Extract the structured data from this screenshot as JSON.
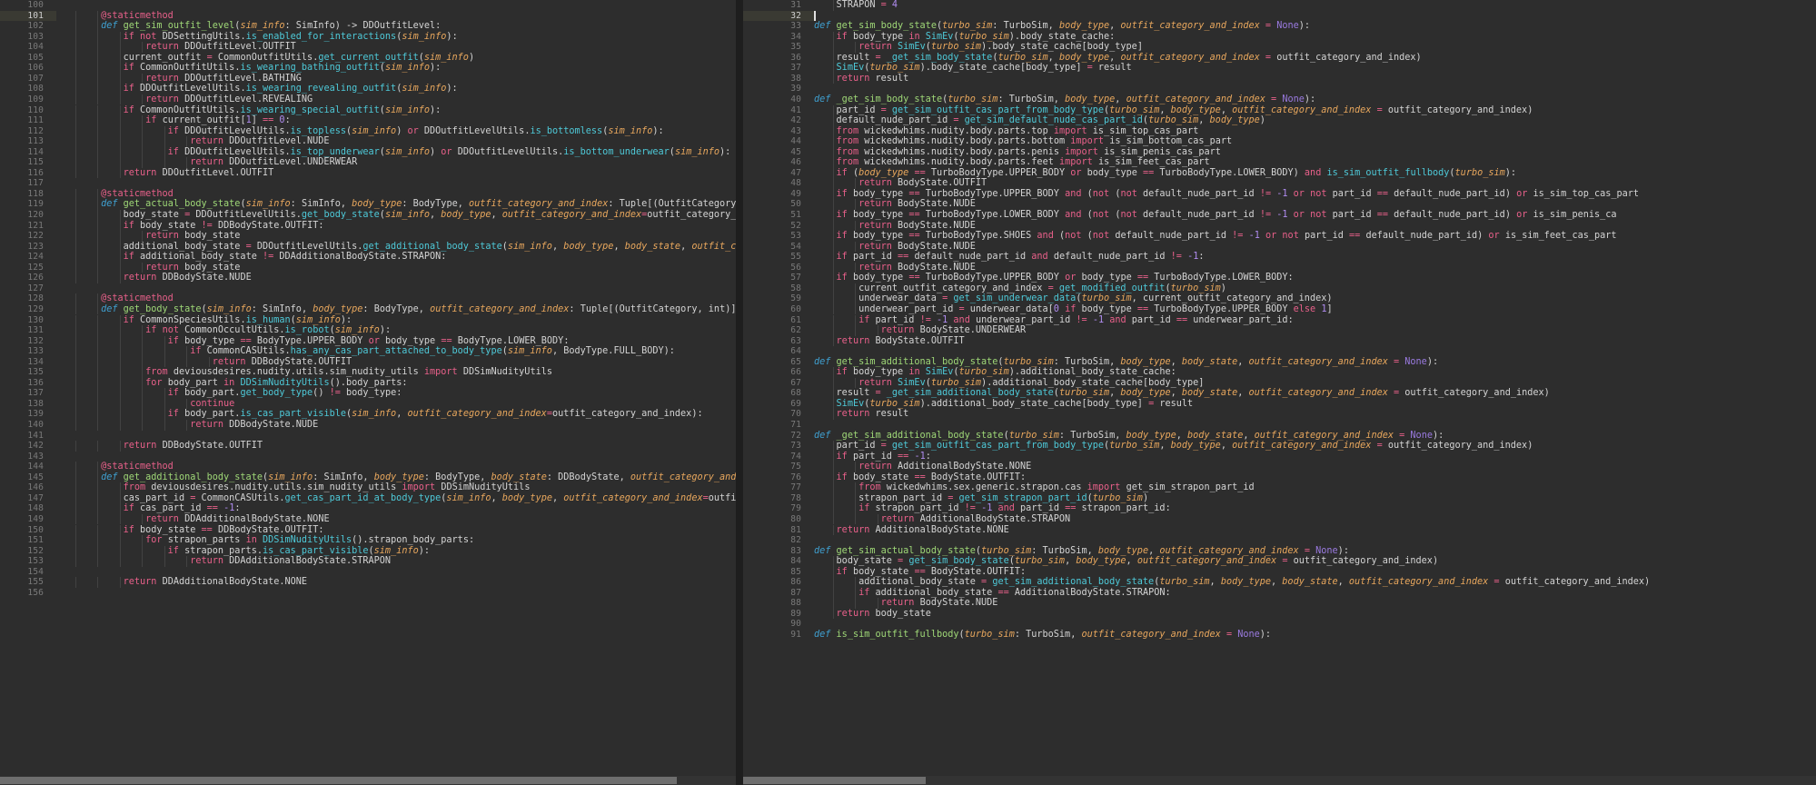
{
  "editor": {
    "theme_bg": "#2d2d2d",
    "gutter_fg": "#797979",
    "active_line_bg": "#3a3a33",
    "divider_color": "#1e1e1e",
    "scrollbar_thumb": "#6e6e6e"
  },
  "left_pane": {
    "name": "left-editor-pane",
    "language": "python",
    "first_visible_line": 100,
    "active_line": 101,
    "horizontal_scroll_thumb_percent": 92,
    "lines": [
      {
        "n": 100,
        "text": ""
      },
      {
        "n": 101,
        "text": "        @staticmethod"
      },
      {
        "n": 102,
        "text": "        def get_sim_outfit_level(sim_info: SimInfo) -> DDOutfitLevel:"
      },
      {
        "n": 103,
        "text": "            if not DDSettingUtils.is_enabled_for_interactions(sim_info):"
      },
      {
        "n": 104,
        "text": "                return DDOutfitLevel.OUTFIT"
      },
      {
        "n": 105,
        "text": "            current_outfit = CommonOutfitUtils.get_current_outfit(sim_info)"
      },
      {
        "n": 106,
        "text": "            if CommonOutfitUtils.is_wearing_bathing_outfit(sim_info):"
      },
      {
        "n": 107,
        "text": "                return DDOutfitLevel.BATHING"
      },
      {
        "n": 108,
        "text": "            if DDOutfitLevelUtils.is_wearing_revealing_outfit(sim_info):"
      },
      {
        "n": 109,
        "text": "                return DDOutfitLevel.REVEALING"
      },
      {
        "n": 110,
        "text": "            if CommonOutfitUtils.is_wearing_special_outfit(sim_info):"
      },
      {
        "n": 111,
        "text": "                if current_outfit[1] == 0:"
      },
      {
        "n": 112,
        "text": "                    if DDOutfitLevelUtils.is_topless(sim_info) or DDOutfitLevelUtils.is_bottomless(sim_info):"
      },
      {
        "n": 113,
        "text": "                        return DDOutfitLevel.NUDE"
      },
      {
        "n": 114,
        "text": "                    if DDOutfitLevelUtils.is_top_underwear(sim_info) or DDOutfitLevelUtils.is_bottom_underwear(sim_info):"
      },
      {
        "n": 115,
        "text": "                        return DDOutfitLevel.UNDERWEAR"
      },
      {
        "n": 116,
        "text": "            return DDOutfitLevel.OUTFIT"
      },
      {
        "n": 117,
        "text": ""
      },
      {
        "n": 118,
        "text": "        @staticmethod"
      },
      {
        "n": 119,
        "text": "        def get_actual_body_state(sim_info: SimInfo, body_type: BodyType, outfit_category_and_index: Tuple[(OutfitCategory, int)]=None) -> DDBodyState:"
      },
      {
        "n": 120,
        "text": "            body_state = DDOutfitLevelUtils.get_body_state(sim_info, body_type, outfit_category_and_index=outfit_category_and_index)"
      },
      {
        "n": 121,
        "text": "            if body_state != DDBodyState.OUTFIT:"
      },
      {
        "n": 122,
        "text": "                return body_state"
      },
      {
        "n": 123,
        "text": "            additional_body_state = DDOutfitLevelUtils.get_additional_body_state(sim_info, body_type, body_state, outfit_category_and_index=outfit_category_and_index)"
      },
      {
        "n": 124,
        "text": "            if additional_body_state != DDAdditionalBodyState.STRAPON:"
      },
      {
        "n": 125,
        "text": "                return body_state"
      },
      {
        "n": 126,
        "text": "            return DDBodyState.NUDE"
      },
      {
        "n": 127,
        "text": ""
      },
      {
        "n": 128,
        "text": "        @staticmethod"
      },
      {
        "n": 129,
        "text": "        def get_body_state(sim_info: SimInfo, body_type: BodyType, outfit_category_and_index: Tuple[(OutfitCategory, int)]=None) -> DDBodyState:"
      },
      {
        "n": 130,
        "text": "            if CommonSpeciesUtils.is_human(sim_info):"
      },
      {
        "n": 131,
        "text": "                if not CommonOccultUtils.is_robot(sim_info):"
      },
      {
        "n": 132,
        "text": "                    if body_type == BodyType.UPPER_BODY or body_type == BodyType.LOWER_BODY:"
      },
      {
        "n": 133,
        "text": "                        if CommonCASUtils.has_any_cas_part_attached_to_body_type(sim_info, BodyType.FULL_BODY):"
      },
      {
        "n": 134,
        "text": "                            return DDBodyState.OUTFIT"
      },
      {
        "n": 135,
        "text": "                from deviousdesires.nudity.utils.sim_nudity_utils import DDSimNudityUtils"
      },
      {
        "n": 136,
        "text": "                for body_part in DDSimNudityUtils().body_parts:"
      },
      {
        "n": 137,
        "text": "                    if body_part.get_body_type() != body_type:"
      },
      {
        "n": 138,
        "text": "                        continue"
      },
      {
        "n": 139,
        "text": "                    if body_part.is_cas_part_visible(sim_info, outfit_category_and_index=outfit_category_and_index):"
      },
      {
        "n": 140,
        "text": "                        return DDBodyState.NUDE"
      },
      {
        "n": 141,
        "text": ""
      },
      {
        "n": 142,
        "text": "            return DDBodyState.OUTFIT"
      },
      {
        "n": 143,
        "text": ""
      },
      {
        "n": 144,
        "text": "        @staticmethod"
      },
      {
        "n": 145,
        "text": "        def get_additional_body_state(sim_info: SimInfo, body_type: BodyType, body_state: DDBodyState, outfit_category_and_index: Tuple[(OutfitCategory, int)]=None) -> DDAdditionalBodyState:"
      },
      {
        "n": 146,
        "text": "            from deviousdesires.nudity.utils.sim_nudity_utils import DDSimNudityUtils"
      },
      {
        "n": 147,
        "text": "            cas_part_id = CommonCASUtils.get_cas_part_id_at_body_type(sim_info, body_type, outfit_category_and_index=outfit_category_and_index)"
      },
      {
        "n": 148,
        "text": "            if cas_part_id == -1:"
      },
      {
        "n": 149,
        "text": "                return DDAdditionalBodyState.NONE"
      },
      {
        "n": 150,
        "text": "            if body_state == DDBodyState.OUTFIT:"
      },
      {
        "n": 151,
        "text": "                for strapon_parts in DDSimNudityUtils().strapon_body_parts:"
      },
      {
        "n": 152,
        "text": "                    if strapon_parts.is_cas_part_visible(sim_info):"
      },
      {
        "n": 153,
        "text": "                        return DDAdditionalBodyState.STRAPON"
      },
      {
        "n": 154,
        "text": ""
      },
      {
        "n": 155,
        "text": "            return DDAdditionalBodyState.NONE"
      },
      {
        "n": 156,
        "text": ""
      }
    ]
  },
  "right_pane": {
    "name": "right-editor-pane",
    "language": "python",
    "first_visible_line": 31,
    "active_line": 32,
    "cursor_line": 32,
    "cursor_column": 1,
    "horizontal_scroll_thumb_percent": 17,
    "lines": [
      {
        "n": 31,
        "text": "    STRAPON = 4"
      },
      {
        "n": 32,
        "text": ""
      },
      {
        "n": 33,
        "text": "def get_sim_body_state(turbo_sim: TurboSim, body_type, outfit_category_and_index = None):"
      },
      {
        "n": 34,
        "text": "    if body_type in SimEv(turbo_sim).body_state_cache:"
      },
      {
        "n": 35,
        "text": "        return SimEv(turbo_sim).body_state_cache[body_type]"
      },
      {
        "n": 36,
        "text": "    result = _get_sim_body_state(turbo_sim, body_type, outfit_category_and_index = outfit_category_and_index)"
      },
      {
        "n": 37,
        "text": "    SimEv(turbo_sim).body_state_cache[body_type] = result"
      },
      {
        "n": 38,
        "text": "    return result"
      },
      {
        "n": 39,
        "text": ""
      },
      {
        "n": 40,
        "text": "def _get_sim_body_state(turbo_sim: TurboSim, body_type, outfit_category_and_index = None):"
      },
      {
        "n": 41,
        "text": "    part_id = get_sim_outfit_cas_part_from_body_type(turbo_sim, body_type, outfit_category_and_index = outfit_category_and_index)"
      },
      {
        "n": 42,
        "text": "    default_nude_part_id = get_sim_default_nude_cas_part_id(turbo_sim, body_type)"
      },
      {
        "n": 43,
        "text": "    from wickedwhims.nudity.body.parts.top import is_sim_top_cas_part"
      },
      {
        "n": 44,
        "text": "    from wickedwhims.nudity.body.parts.bottom import is_sim_bottom_cas_part"
      },
      {
        "n": 45,
        "text": "    from wickedwhims.nudity.body.parts.penis import is_sim_penis_cas_part"
      },
      {
        "n": 46,
        "text": "    from wickedwhims.nudity.body.parts.feet import is_sim_feet_cas_part"
      },
      {
        "n": 47,
        "text": "    if (body_type == TurboBodyType.UPPER_BODY or body_type == TurboBodyType.LOWER_BODY) and is_sim_outfit_fullbody(turbo_sim):"
      },
      {
        "n": 48,
        "text": "        return BodyState.OUTFIT"
      },
      {
        "n": 49,
        "text": "    if body_type == TurboBodyType.UPPER_BODY and (not (not default_nude_part_id != -1 or not part_id == default_nude_part_id) or is_sim_top_cas_part"
      },
      {
        "n": 50,
        "text": "        return BodyState.NUDE"
      },
      {
        "n": 51,
        "text": "    if body_type == TurboBodyType.LOWER_BODY and (not (not default_nude_part_id != -1 or not part_id == default_nude_part_id) or is_sim_penis_ca"
      },
      {
        "n": 52,
        "text": "        return BodyState.NUDE"
      },
      {
        "n": 53,
        "text": "    if body_type == TurboBodyType.SHOES and (not (not default_nude_part_id != -1 or not part_id == default_nude_part_id) or is_sim_feet_cas_part"
      },
      {
        "n": 54,
        "text": "        return BodyState.NUDE"
      },
      {
        "n": 55,
        "text": "    if part_id == default_nude_part_id and default_nude_part_id != -1:"
      },
      {
        "n": 56,
        "text": "        return BodyState.NUDE"
      },
      {
        "n": 57,
        "text": "    if body_type == TurboBodyType.UPPER_BODY or body_type == TurboBodyType.LOWER_BODY:"
      },
      {
        "n": 58,
        "text": "        current_outfit_category_and_index = get_modified_outfit(turbo_sim)"
      },
      {
        "n": 59,
        "text": "        underwear_data = get_sim_underwear_data(turbo_sim, current_outfit_category_and_index)"
      },
      {
        "n": 60,
        "text": "        underwear_part_id = underwear_data[0 if body_type == TurboBodyType.UPPER_BODY else 1]"
      },
      {
        "n": 61,
        "text": "        if part_id != -1 and underwear_part_id != -1 and part_id == underwear_part_id:"
      },
      {
        "n": 62,
        "text": "            return BodyState.UNDERWEAR"
      },
      {
        "n": 63,
        "text": "    return BodyState.OUTFIT"
      },
      {
        "n": 64,
        "text": ""
      },
      {
        "n": 65,
        "text": "def get_sim_additional_body_state(turbo_sim: TurboSim, body_type, body_state, outfit_category_and_index = None):"
      },
      {
        "n": 66,
        "text": "    if body_type in SimEv(turbo_sim).additional_body_state_cache:"
      },
      {
        "n": 67,
        "text": "        return SimEv(turbo_sim).additional_body_state_cache[body_type]"
      },
      {
        "n": 68,
        "text": "    result = _get_sim_additional_body_state(turbo_sim, body_type, body_state, outfit_category_and_index = outfit_category_and_index)"
      },
      {
        "n": 69,
        "text": "    SimEv(turbo_sim).additional_body_state_cache[body_type] = result"
      },
      {
        "n": 70,
        "text": "    return result"
      },
      {
        "n": 71,
        "text": ""
      },
      {
        "n": 72,
        "text": "def _get_sim_additional_body_state(turbo_sim: TurboSim, body_type, body_state, outfit_category_and_index = None):"
      },
      {
        "n": 73,
        "text": "    part_id = get_sim_outfit_cas_part_from_body_type(turbo_sim, body_type, outfit_category_and_index = outfit_category_and_index)"
      },
      {
        "n": 74,
        "text": "    if part_id == -1:"
      },
      {
        "n": 75,
        "text": "        return AdditionalBodyState.NONE"
      },
      {
        "n": 76,
        "text": "    if body_state == BodyState.OUTFIT:"
      },
      {
        "n": 77,
        "text": "        from wickedwhims.sex.generic.strapon.cas import get_sim_strapon_part_id"
      },
      {
        "n": 78,
        "text": "        strapon_part_id = get_sim_strapon_part_id(turbo_sim)"
      },
      {
        "n": 79,
        "text": "        if strapon_part_id != -1 and part_id == strapon_part_id:"
      },
      {
        "n": 80,
        "text": "            return AdditionalBodyState.STRAPON"
      },
      {
        "n": 81,
        "text": "    return AdditionalBodyState.NONE"
      },
      {
        "n": 82,
        "text": ""
      },
      {
        "n": 83,
        "text": "def get_sim_actual_body_state(turbo_sim: TurboSim, body_type, outfit_category_and_index = None):"
      },
      {
        "n": 84,
        "text": "    body_state = get_sim_body_state(turbo_sim, body_type, outfit_category_and_index = outfit_category_and_index)"
      },
      {
        "n": 85,
        "text": "    if body_state == BodyState.OUTFIT:"
      },
      {
        "n": 86,
        "text": "        additional_body_state = get_sim_additional_body_state(turbo_sim, body_type, body_state, outfit_category_and_index = outfit_category_and_index)"
      },
      {
        "n": 87,
        "text": "        if additional_body_state == AdditionalBodyState.STRAPON:"
      },
      {
        "n": 88,
        "text": "            return BodyState.NUDE"
      },
      {
        "n": 89,
        "text": "    return body_state"
      },
      {
        "n": 90,
        "text": ""
      },
      {
        "n": 91,
        "text": "def is_sim_outfit_fullbody(turbo_sim: TurboSim, outfit_category_and_index = None):"
      }
    ]
  },
  "syntax_colors": {
    "keyword": "#e8608a",
    "function_name": "#9fd877",
    "method_call": "#4ec9d8",
    "parameter": "#e8a75d",
    "number": "#b08cf0",
    "none_literal": "#9a7ae0",
    "plain": "#d4d4d4",
    "line_number": "#797979",
    "def_keyword": "#3f9fcf"
  }
}
